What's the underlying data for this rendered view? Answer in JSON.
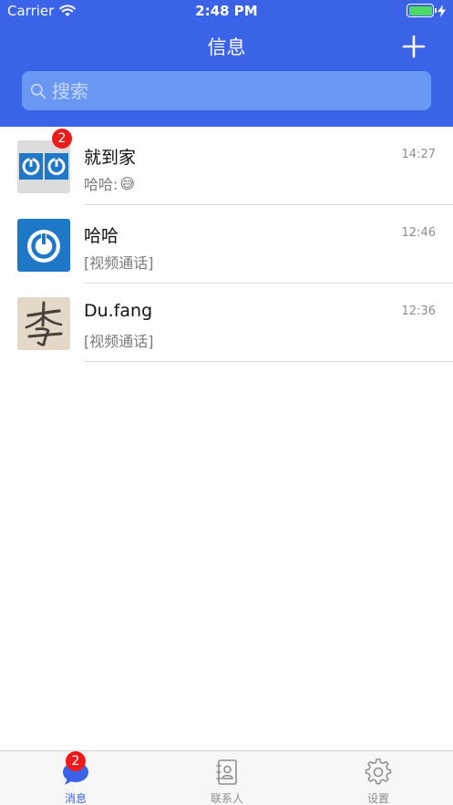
{
  "status_bar": {
    "carrier": "Carrier",
    "time": "2:48 PM",
    "wifi_icon": "wifi-icon",
    "battery_icon": "battery-icon",
    "charging_icon": "bolt-icon"
  },
  "nav": {
    "title": "信息",
    "add_icon": "plus-icon"
  },
  "search": {
    "placeholder": "搜索",
    "icon": "search-icon"
  },
  "conversations": [
    {
      "name": "就到家",
      "preview": "哈哈:",
      "preview_emoji": "😅",
      "time": "14:27",
      "unread": "2",
      "avatar": "double-power-logo"
    },
    {
      "name": "哈哈",
      "preview": "[视频通话]",
      "time": "12:46",
      "avatar": "power-logo"
    },
    {
      "name": "Du.fang",
      "preview": "[视频通话]",
      "time": "12:36",
      "avatar": "calligraphy-li"
    }
  ],
  "tabs": [
    {
      "label": "消息",
      "badge": "2",
      "icon": "chat-bubble-icon",
      "active": true
    },
    {
      "label": "联系人",
      "icon": "contacts-book-icon"
    },
    {
      "label": "设置",
      "icon": "gear-icon"
    }
  ],
  "colors": {
    "header_blue": "#3b63e8",
    "search_bg": "#6a97f4",
    "badge_red": "#ec1c1c",
    "battery_green": "#4cd964",
    "logo_blue": "#1f77c8"
  }
}
